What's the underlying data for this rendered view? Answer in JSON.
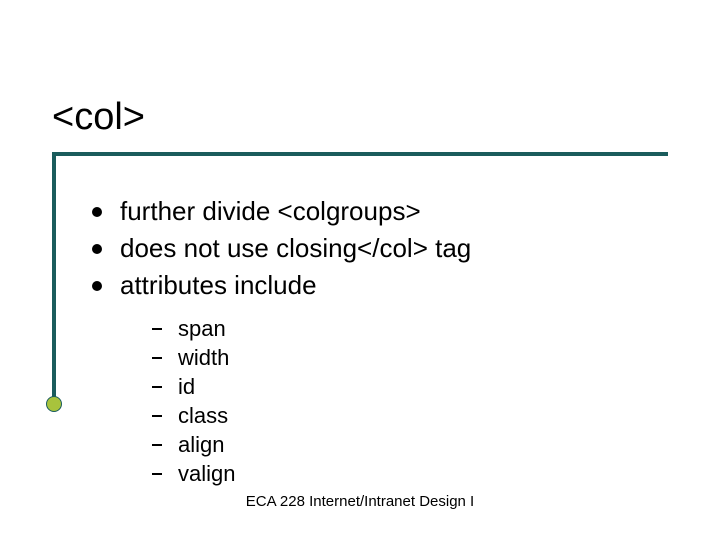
{
  "title": "<col>",
  "bullets": [
    "further divide <colgroups>",
    "does not use closing</col> tag",
    "attributes include"
  ],
  "sub_bullets": [
    "span",
    "width",
    "id",
    "class",
    "align",
    "valign"
  ],
  "footer": "ECA 228  Internet/Intranet Design I"
}
